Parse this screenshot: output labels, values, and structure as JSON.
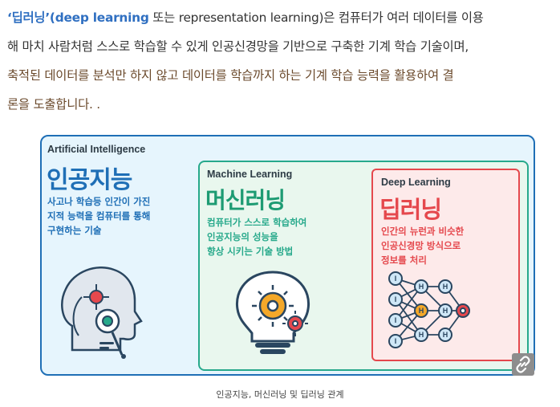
{
  "paragraph": {
    "lead_term": "‘딥러닝’(deep learning",
    "line1_rest": " 또는 representation learning)은  컴퓨터가 여러 데이터를 이용",
    "line2": "해 마치 사람처럼 스스로 학습할 수 있게 인공신경망을 기반으로 구축한 기계 학습 기술이며,",
    "line3": "축적된 데이터를 분석만 하지 않고 데이터를 학습까지 하는 기계 학습 능력을 활용하여 결",
    "line4": "론을 도출합니다. ."
  },
  "figure": {
    "ai": {
      "english": "Artificial Intelligence",
      "title": "인공지능",
      "desc": [
        "사고나 학습등 인간이 가진",
        "지적 능력을 컴퓨터를 통해",
        "구현하는 기술"
      ]
    },
    "ml": {
      "english": "Machine Learning",
      "title": "머신러닝",
      "desc": [
        "컴퓨터가 스스로 학습하여",
        "인공지능의 성능을",
        "향상 시키는 기술 방법"
      ]
    },
    "dl": {
      "english": "Deep Learning",
      "title": "딥러닝",
      "desc": [
        "인간의 뉴런과 비슷한",
        "인공신경망 방식으로",
        "정보를 처리"
      ],
      "nodes": {
        "input": "I",
        "hidden": "H"
      }
    },
    "icons": [
      "robot-head-icon",
      "lightbulb-gears-icon",
      "neural-network-icon",
      "link-icon"
    ],
    "colors": {
      "ai": "#1f6fb6",
      "ml": "#27a98b",
      "dl": "#e5484d"
    }
  },
  "caption": "인공지능, 머신러닝 및 딥러닝 관계"
}
